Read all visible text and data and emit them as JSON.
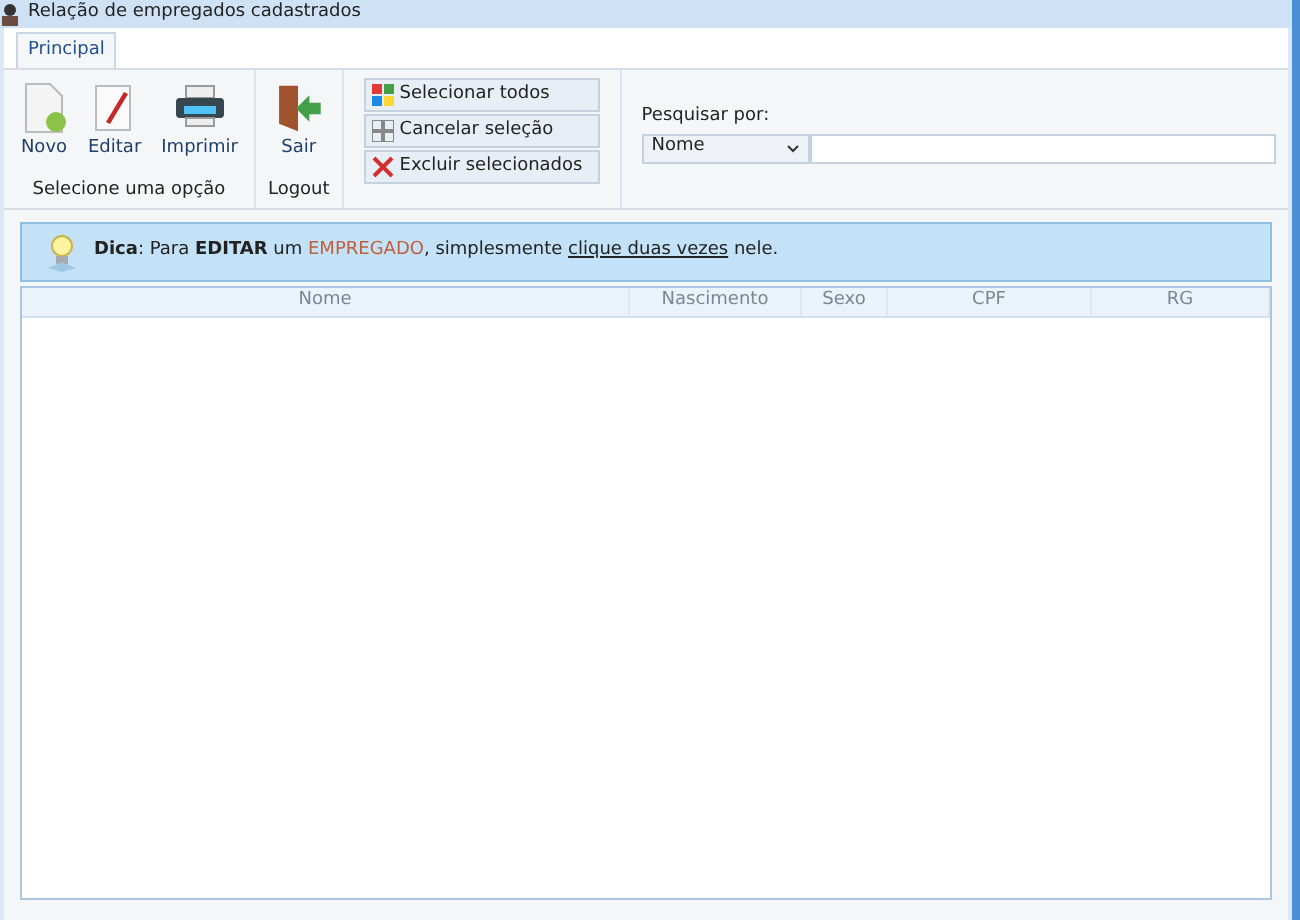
{
  "window": {
    "title": "Relação de empregados cadastrados"
  },
  "tabs": [
    {
      "label": "Principal",
      "selected": true
    }
  ],
  "ribbon": {
    "groups": [
      {
        "label": "Selecione uma opção",
        "buttons": [
          {
            "label": "Novo",
            "kind": "new"
          },
          {
            "label": "Editar",
            "kind": "edit"
          },
          {
            "label": "Imprimir",
            "kind": "print"
          }
        ]
      },
      {
        "label": "Logout",
        "buttons": [
          {
            "label": "Sair",
            "kind": "exit"
          }
        ]
      }
    ],
    "selection_buttons": [
      {
        "label": "Selecionar todos",
        "kind": "grid"
      },
      {
        "label": "Cancelar seleção",
        "kind": "dots"
      },
      {
        "label": "Excluir selecionados",
        "kind": "x"
      }
    ],
    "search": {
      "label": "Pesquisar por:",
      "field": "Nome"
    }
  },
  "tip": {
    "parts": [
      {
        "kind": "bold",
        "text": "Dica"
      },
      {
        "kind": "plain",
        "text": ": Para "
      },
      {
        "kind": "bold",
        "text": "EDITAR"
      },
      {
        "kind": "plain",
        "text": " um "
      },
      {
        "kind": "accent",
        "text": "EMPREGADO"
      },
      {
        "kind": "plain",
        "text": ", simplesmente "
      },
      {
        "kind": "link",
        "text": "clique duas vezes"
      },
      {
        "kind": "plain",
        "text": " nele."
      }
    ]
  },
  "table": {
    "columns": [
      "Nome",
      "Nascimento",
      "Sexo",
      "CPF",
      "RG"
    ]
  }
}
